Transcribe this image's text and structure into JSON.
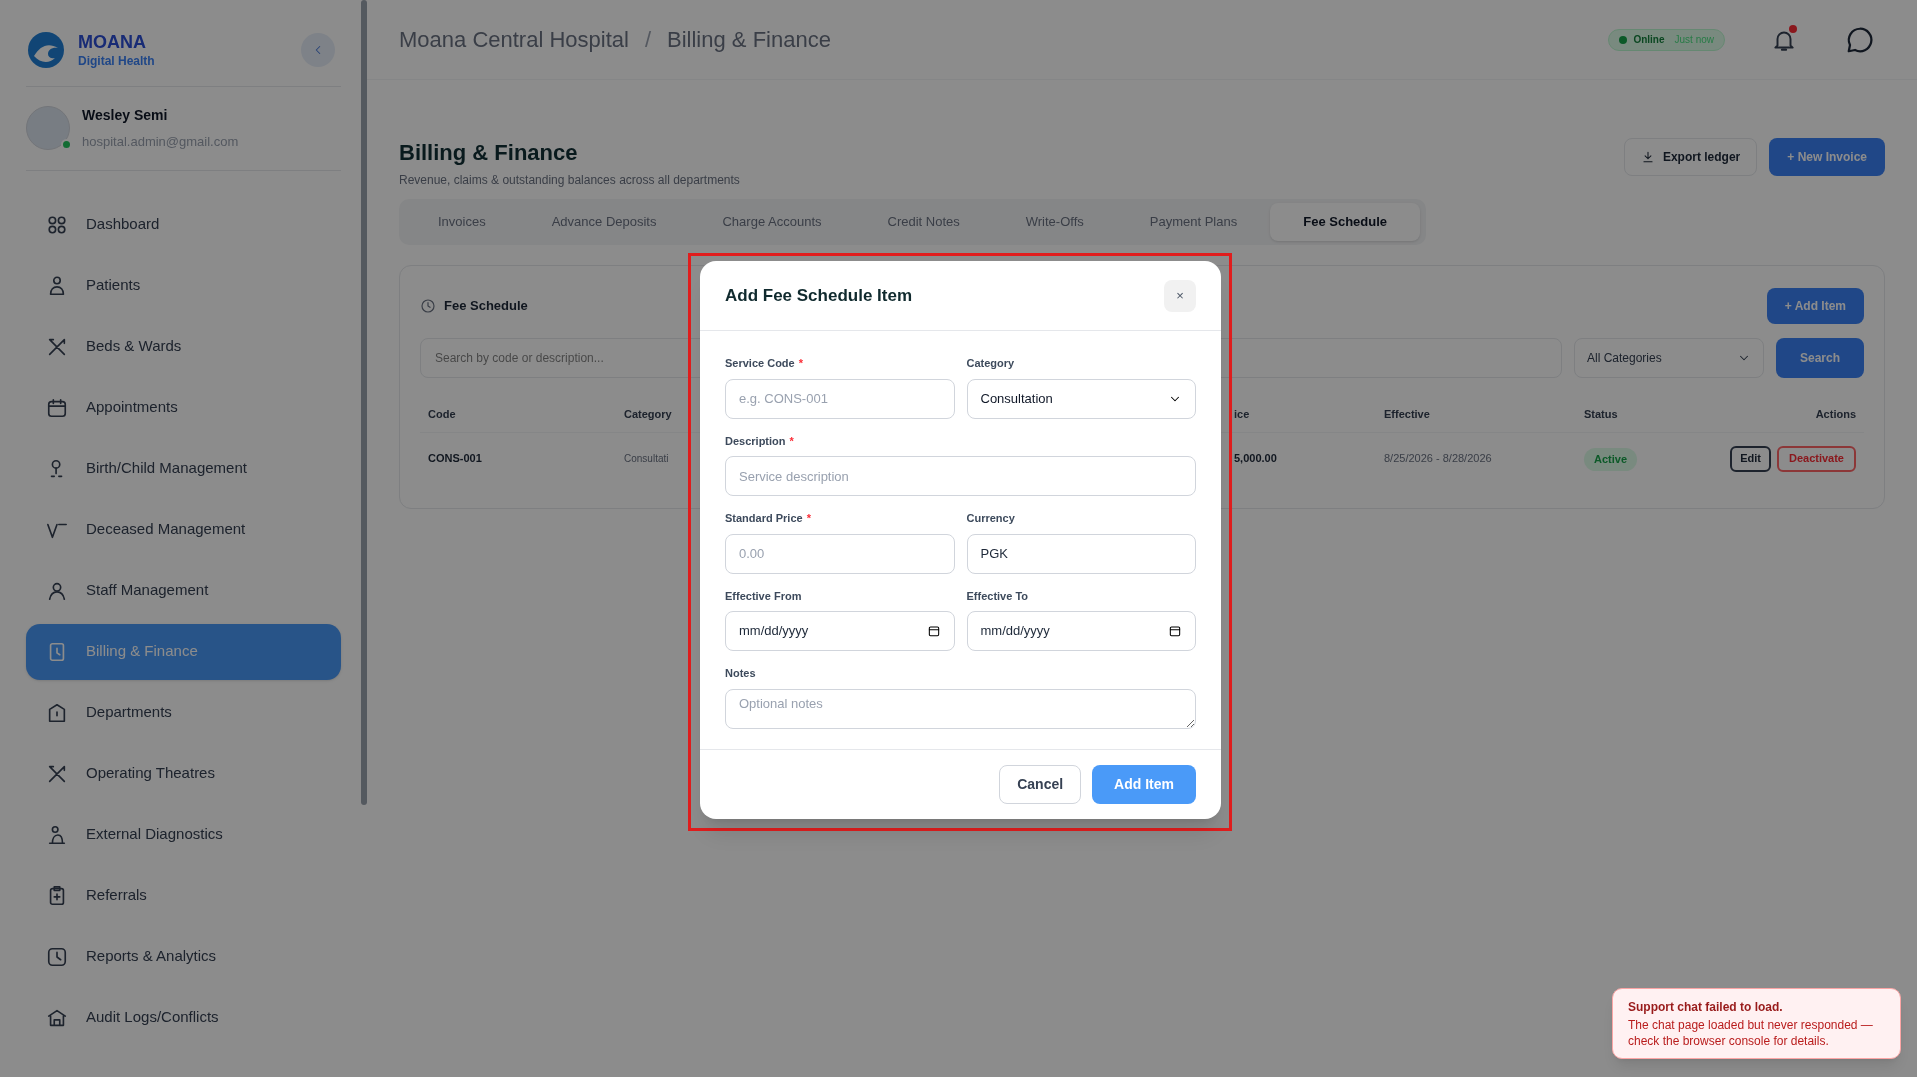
{
  "brand": {
    "name": "MOANA",
    "tagline": "Digital Health"
  },
  "user": {
    "name": "Wesley Semi",
    "email": "hospital.admin@gmail.com",
    "online": true
  },
  "sidebar": {
    "items": [
      {
        "label": "Dashboard",
        "selected": false
      },
      {
        "label": "Patients",
        "selected": false
      },
      {
        "label": "Beds & Wards",
        "selected": false
      },
      {
        "label": "Appointments",
        "selected": false
      },
      {
        "label": "Birth/Child Management",
        "selected": false
      },
      {
        "label": "Deceased Management",
        "selected": false
      },
      {
        "label": "Staff Management",
        "selected": false
      },
      {
        "label": "Billing & Finance",
        "selected": true
      },
      {
        "label": "Departments",
        "selected": false
      },
      {
        "label": "Operating Theatres",
        "selected": false
      },
      {
        "label": "External Diagnostics",
        "selected": false
      },
      {
        "label": "Referrals",
        "selected": false
      },
      {
        "label": "Reports & Analytics",
        "selected": false
      },
      {
        "label": "Audit Logs/Conflicts",
        "selected": false
      }
    ]
  },
  "header": {
    "breadcrumb": [
      "Moana Central Hospital",
      "Billing & Finance"
    ],
    "breadcrumb_separator": "/",
    "status": {
      "label": "Online",
      "detail": "Just now"
    },
    "notifications": {
      "unread": true
    }
  },
  "page": {
    "title": "Billing & Finance",
    "subtitle": "Revenue, claims & outstanding balances across all departments",
    "actions": [
      {
        "label": "Export ledger",
        "kind": "secondary"
      },
      {
        "label": "+ New Invoice",
        "kind": "primary"
      }
    ]
  },
  "tabs": [
    {
      "label": "Invoices",
      "selected": false
    },
    {
      "label": "Advance Deposits",
      "selected": false
    },
    {
      "label": "Charge Accounts",
      "selected": false
    },
    {
      "label": "Credit Notes",
      "selected": false
    },
    {
      "label": "Write-Offs",
      "selected": false
    },
    {
      "label": "Payment Plans",
      "selected": false
    },
    {
      "label": "Fee Schedule",
      "selected": true
    }
  ],
  "fee_schedule": {
    "title": "Fee Schedule",
    "add_button": "+ Add Item",
    "search": {
      "placeholder": "Search by code or description..."
    },
    "category_filter": "All Categories",
    "search_button": "Search",
    "table": {
      "columns": [
        "Code",
        "Category",
        "ice",
        "Effective",
        "Status",
        "Actions"
      ],
      "rows": [
        {
          "code": "CONS-001",
          "category": "Consultati",
          "price": "5,000.00",
          "effective": "8/25/2026 - 8/28/2026",
          "status": "Active",
          "actions": [
            "Edit",
            "Deactivate"
          ]
        }
      ]
    }
  },
  "dialog": {
    "title": "Add Fee Schedule Item",
    "close": "×",
    "fields": [
      {
        "kind": "text",
        "label": "Service Code",
        "required_mark": "*",
        "placeholder": "e.g. CONS-001",
        "half": true
      },
      {
        "kind": "select",
        "label": "Category",
        "value": "Consultation",
        "half": true
      },
      {
        "kind": "text",
        "label": "Description",
        "required_mark": "*",
        "placeholder": "Service description",
        "half": false
      },
      {
        "kind": "text",
        "label": "Standard Price",
        "required_mark": "*",
        "placeholder": "0.00",
        "half": true
      },
      {
        "kind": "text",
        "label": "Currency",
        "value": "PGK",
        "half": true
      },
      {
        "kind": "date",
        "label": "Effective From",
        "placeholder": "mm/dd/yyyy",
        "half": true
      },
      {
        "kind": "date",
        "label": "Effective To",
        "placeholder": "mm/dd/yyyy",
        "half": true
      },
      {
        "kind": "textarea",
        "label": "Notes",
        "placeholder": "Optional notes",
        "half": false
      }
    ],
    "buttons": [
      {
        "label": "Cancel",
        "kind": "secondary"
      },
      {
        "label": "Add Item",
        "kind": "primary"
      }
    ]
  },
  "toast": {
    "title": "Support chat failed to load.",
    "message": "The chat page loaded but never responded — check the browser console for details."
  }
}
